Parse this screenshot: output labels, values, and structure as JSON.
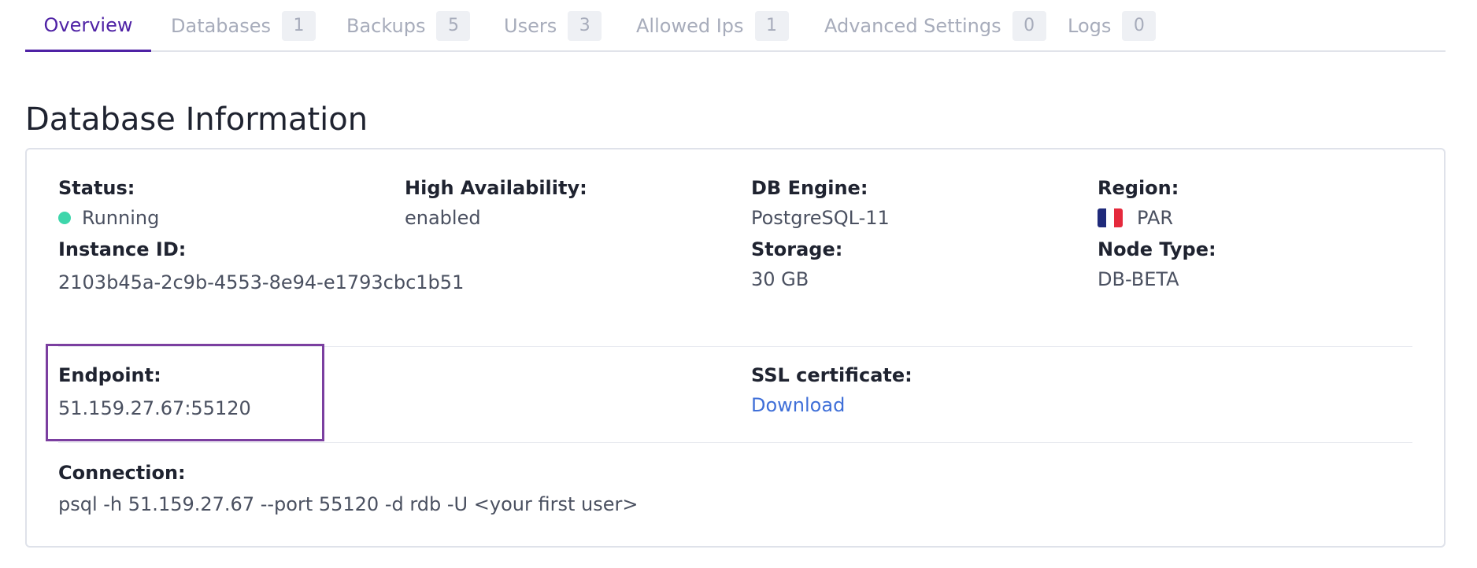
{
  "tabs": [
    {
      "label": "Overview",
      "count": null,
      "active": true
    },
    {
      "label": "Databases",
      "count": "1"
    },
    {
      "label": "Backups",
      "count": "5"
    },
    {
      "label": "Users",
      "count": "3"
    },
    {
      "label": "Allowed Ips",
      "count": "1"
    },
    {
      "label": "Advanced Settings",
      "count": "0"
    },
    {
      "label": "Logs",
      "count": "0"
    }
  ],
  "section_title": "Database Information",
  "info": {
    "status": {
      "label": "Status:",
      "value": "Running",
      "color": "#3ed6ab"
    },
    "high_availability": {
      "label": "High Availability:",
      "value": "enabled"
    },
    "db_engine": {
      "label": "DB Engine:",
      "value": "PostgreSQL-11"
    },
    "region": {
      "label": "Region:",
      "value": "PAR",
      "flag": "france-flag-icon"
    },
    "instance_id": {
      "label": "Instance ID:",
      "value": "2103b45a-2c9b-4553-8e94-e1793cbc1b51"
    },
    "storage": {
      "label": "Storage:",
      "value": "30 GB"
    },
    "node_type": {
      "label": "Node Type:",
      "value": "DB-BETA"
    },
    "endpoint": {
      "label": "Endpoint:",
      "value": "51.159.27.67:55120"
    },
    "ssl_certificate": {
      "label": "SSL certificate:",
      "link": "Download"
    },
    "connection": {
      "label": "Connection:",
      "value": "psql -h 51.159.27.67 --port 55120 -d rdb -U <your first user>"
    }
  },
  "colors": {
    "accent": "#4f22a5",
    "highlight": "#7b3fa0",
    "link": "#3f6fd8"
  }
}
